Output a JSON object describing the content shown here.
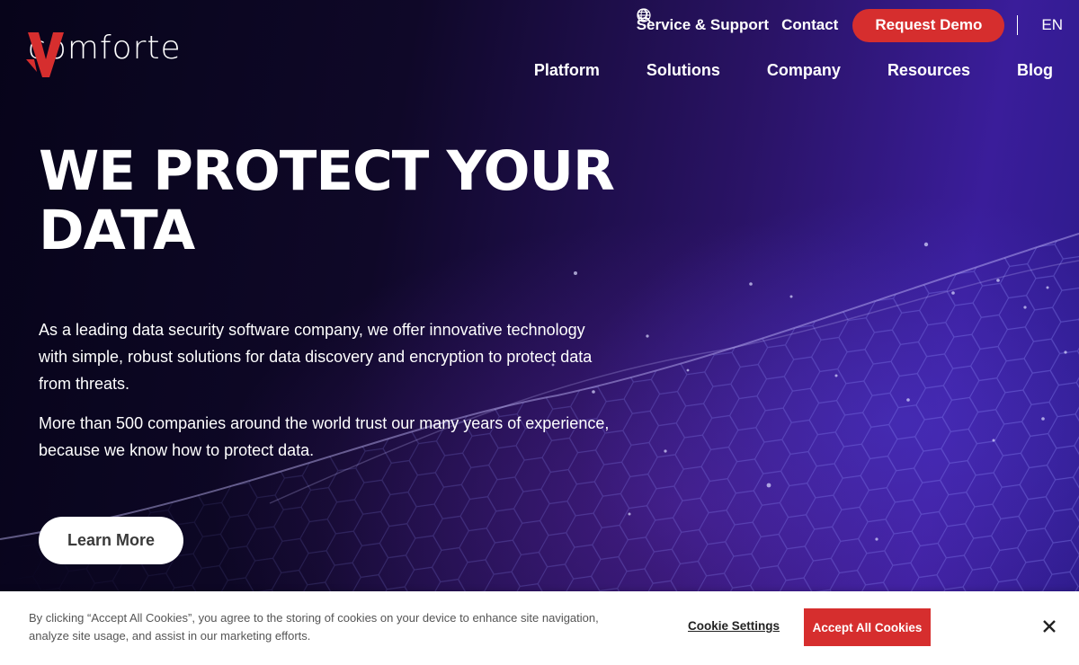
{
  "brand": {
    "logo_text": "comforte"
  },
  "utility_nav": {
    "service_support": "Service & Support",
    "contact": "Contact",
    "request_demo": "Request Demo",
    "language": "EN"
  },
  "main_nav": {
    "items": [
      "Platform",
      "Solutions",
      "Company",
      "Resources",
      "Blog"
    ]
  },
  "hero": {
    "headline_line1": "WE PROTECT YOUR",
    "headline_line2": "DATA",
    "paragraph1": "As a leading data security software company, we offer innovative technology with simple, robust solutions for data discovery and encryption to protect data from threats.",
    "paragraph2": "More than 500 companies around the world trust our many years of experience, because we know how to protect data.",
    "cta": "Learn More"
  },
  "cookie_banner": {
    "text": "By clicking “Accept All Cookies”, you agree to the storing of cookies on your device to enhance site navigation, analyze site usage, and assist in our marketing efforts.",
    "settings_label": "Cookie Settings",
    "accept_label": "Accept All Cookies"
  },
  "colors": {
    "accent_red": "#d62e2e",
    "hero_dark": "#0b0620",
    "hero_purple": "#3a1d9a"
  },
  "icons": [
    "search-icon",
    "globe-icon",
    "close-icon"
  ]
}
